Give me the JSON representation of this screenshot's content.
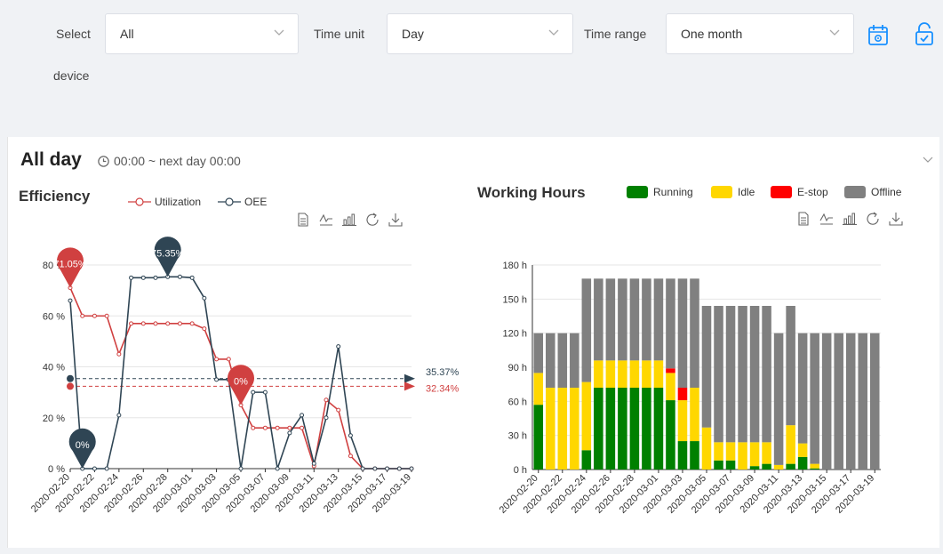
{
  "filters": {
    "device": {
      "label_line1": "Select",
      "label_line2": "device",
      "value": "All"
    },
    "time_unit": {
      "label": "Time unit",
      "value": "Day"
    },
    "time_range": {
      "label": "Time range",
      "value": "One month"
    }
  },
  "panel": {
    "title": "All day",
    "time": "00:00 ~ next day 00:00"
  },
  "colors": {
    "utilization": "#d04040",
    "oee": "#2f4554",
    "running": "#008000",
    "idle": "#ffd700",
    "estop": "#ff0000",
    "offline": "#808080",
    "accent": "#1890ff"
  },
  "efficiency": {
    "title": "Efficiency",
    "legend": [
      "Utilization",
      "OEE"
    ],
    "pins": {
      "util_max": "71.05%",
      "oee_max": "75.35%",
      "oee_min": "0%",
      "util_min": "0%"
    },
    "avg_labels": {
      "oee": "35.37%",
      "util": "32.34%"
    },
    "y_ticks": [
      "0 %",
      "20 %",
      "40 %",
      "60 %",
      "80 %"
    ],
    "x_ticks": [
      "2020-02-20",
      "2020-02-22",
      "2020-02-24",
      "2020-02-26",
      "2020-02-28",
      "2020-03-01",
      "2020-03-03",
      "2020-03-05",
      "2020-03-07",
      "2020-03-09",
      "2020-03-11",
      "2020-03-13",
      "2020-03-15",
      "2020-03-17",
      "2020-03-19"
    ]
  },
  "working": {
    "title": "Working Hours",
    "legend": [
      "Running",
      "Idle",
      "E-stop",
      "Offline"
    ],
    "y_ticks": [
      "0 h",
      "30 h",
      "60 h",
      "90 h",
      "120 h",
      "150 h",
      "180 h"
    ],
    "x_ticks": [
      "2020-02-20",
      "2020-02-22",
      "2020-02-24",
      "2020-02-26",
      "2020-02-28",
      "2020-03-01",
      "2020-03-03",
      "2020-03-05",
      "2020-03-07",
      "2020-03-09",
      "2020-03-11",
      "2020-03-13",
      "2020-03-15",
      "2020-03-17",
      "2020-03-19"
    ]
  },
  "chart_data": [
    {
      "type": "line",
      "title": "Efficiency",
      "x": [
        "2020-02-20",
        "2020-02-21",
        "2020-02-22",
        "2020-02-23",
        "2020-02-24",
        "2020-02-25",
        "2020-02-26",
        "2020-02-27",
        "2020-02-28",
        "2020-02-29",
        "2020-03-01",
        "2020-03-02",
        "2020-03-03",
        "2020-03-04",
        "2020-03-05",
        "2020-03-06",
        "2020-03-07",
        "2020-03-08",
        "2020-03-09",
        "2020-03-10",
        "2020-03-11",
        "2020-03-12",
        "2020-03-13",
        "2020-03-14",
        "2020-03-15",
        "2020-03-16",
        "2020-03-17",
        "2020-03-18",
        "2020-03-19"
      ],
      "ylim": [
        0,
        85
      ],
      "series": [
        {
          "name": "Utilization",
          "values": [
            71.05,
            60,
            60,
            60,
            45,
            57,
            57,
            57,
            57,
            57,
            57,
            55,
            43,
            43,
            25,
            16,
            16,
            16,
            16,
            16,
            1,
            27,
            23,
            5,
            0,
            0,
            0,
            0,
            0
          ]
        },
        {
          "name": "OEE",
          "values": [
            66,
            0,
            0,
            0,
            21,
            75,
            75,
            75,
            75.35,
            75.35,
            75,
            67,
            35,
            35,
            0,
            30,
            30,
            0,
            14,
            21,
            2,
            20,
            48,
            13,
            0,
            0,
            0,
            0,
            0
          ]
        }
      ],
      "average": {
        "OEE": 35.37,
        "Utilization": 32.34
      }
    },
    {
      "type": "bar",
      "title": "Working Hours",
      "categories": [
        "2020-02-20",
        "2020-02-21",
        "2020-02-22",
        "2020-02-23",
        "2020-02-24",
        "2020-02-25",
        "2020-02-26",
        "2020-02-27",
        "2020-02-28",
        "2020-02-29",
        "2020-03-01",
        "2020-03-02",
        "2020-03-03",
        "2020-03-04",
        "2020-03-05",
        "2020-03-06",
        "2020-03-07",
        "2020-03-08",
        "2020-03-09",
        "2020-03-10",
        "2020-03-11",
        "2020-03-12",
        "2020-03-13",
        "2020-03-14",
        "2020-03-15",
        "2020-03-16",
        "2020-03-17",
        "2020-03-18",
        "2020-03-19"
      ],
      "ylim": [
        0,
        180
      ],
      "series": [
        {
          "name": "Running",
          "values": [
            57,
            0,
            0,
            0,
            17,
            72,
            72,
            72,
            72,
            72,
            72,
            61,
            25,
            25,
            0,
            8,
            8,
            0,
            3,
            5,
            0,
            5,
            11,
            1,
            0,
            0,
            0,
            0,
            0
          ]
        },
        {
          "name": "Idle",
          "values": [
            28,
            72,
            72,
            72,
            60,
            24,
            24,
            24,
            24,
            24,
            24,
            24,
            36,
            47,
            37,
            16,
            16,
            24,
            21,
            19,
            4,
            34,
            12,
            4,
            0,
            0,
            0,
            0,
            0
          ]
        },
        {
          "name": "E-stop",
          "values": [
            0,
            0,
            0,
            0,
            0,
            0,
            0,
            0,
            0,
            0,
            0,
            4,
            11,
            0,
            0,
            0,
            0,
            0,
            0,
            0,
            0,
            0,
            0,
            0,
            0,
            0,
            0,
            0,
            0
          ]
        },
        {
          "name": "Offline",
          "values": [
            35,
            48,
            48,
            48,
            91,
            72,
            72,
            72,
            72,
            72,
            72,
            79,
            96,
            96,
            107,
            120,
            120,
            120,
            120,
            120,
            116,
            105,
            97,
            115,
            120,
            120,
            120,
            120,
            120
          ]
        }
      ]
    }
  ]
}
